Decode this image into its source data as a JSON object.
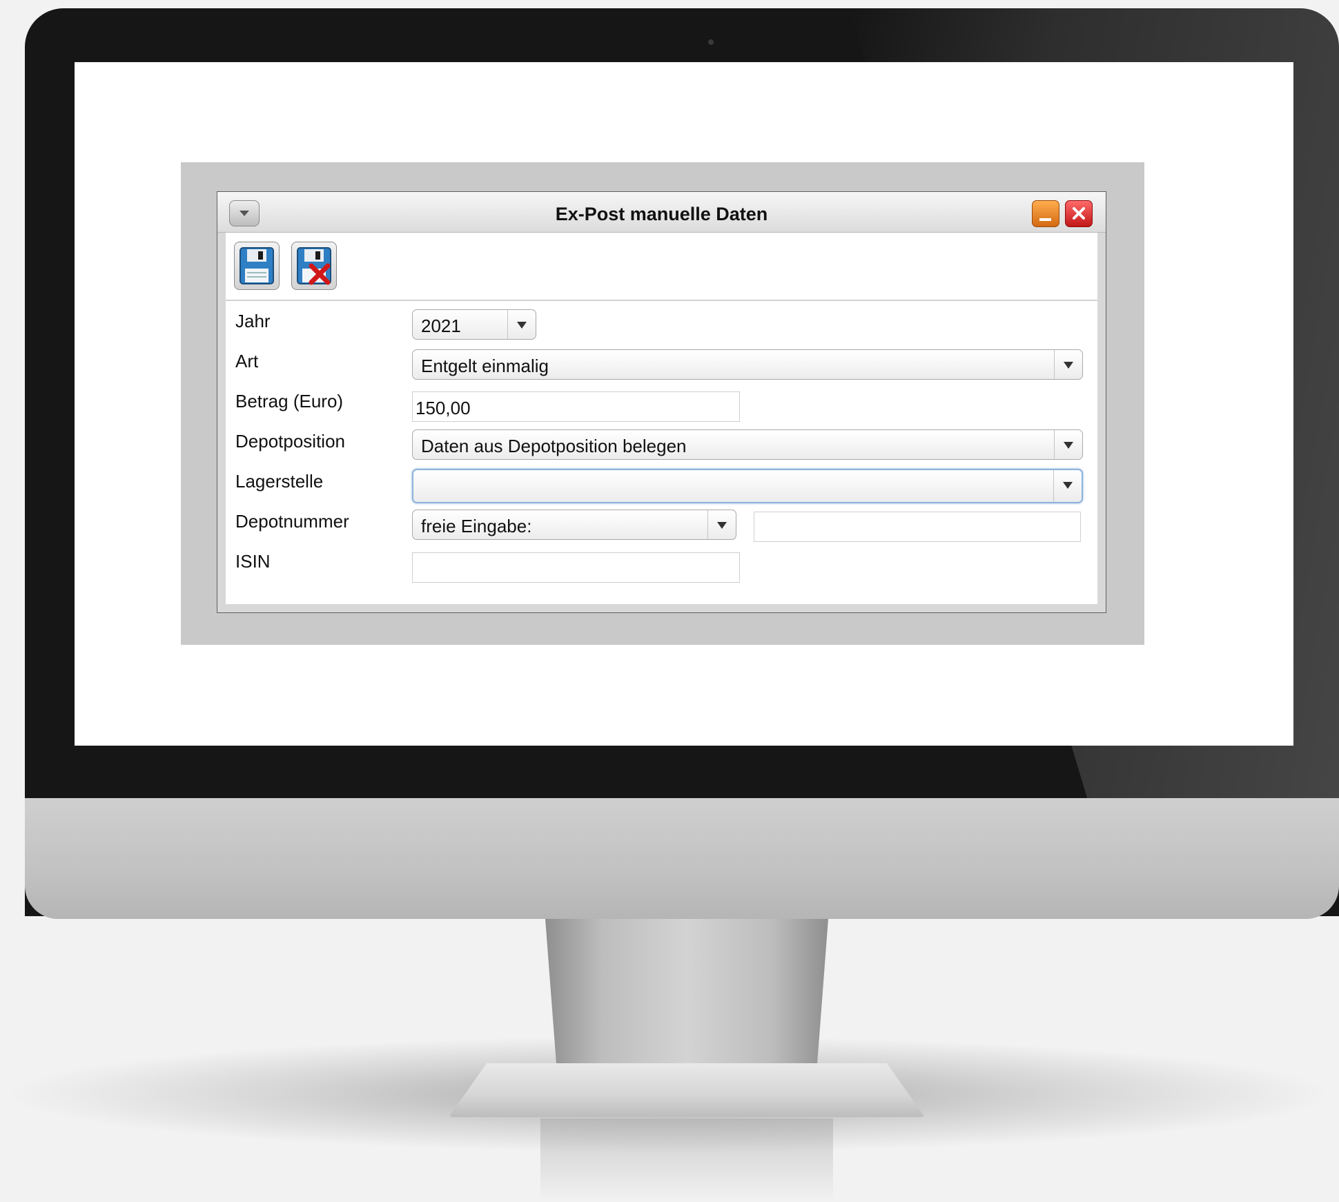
{
  "window": {
    "title": "Ex-Post manuelle Daten"
  },
  "toolbar": {
    "save_icon": "floppy-save-icon",
    "discard_icon": "floppy-discard-icon"
  },
  "form": {
    "jahr_label": "Jahr",
    "jahr_value": "2021",
    "art_label": "Art",
    "art_value": "Entgelt einmalig",
    "betrag_label": "Betrag (Euro)",
    "betrag_value": "150,00",
    "depotposition_label": "Depotposition",
    "depotposition_value": "Daten aus Depotposition belegen",
    "lagerstelle_label": "Lagerstelle",
    "lagerstelle_value": "",
    "depotnummer_label": "Depotnummer",
    "depotnummer_mode": "freie Eingabe:",
    "depotnummer_value": "",
    "isin_label": "ISIN",
    "isin_value": ""
  },
  "colors": {
    "minimize": "#e88a2e",
    "close": "#d92a2a",
    "focus_ring": "#8db3dd",
    "backdrop": "#c9c9c9"
  }
}
